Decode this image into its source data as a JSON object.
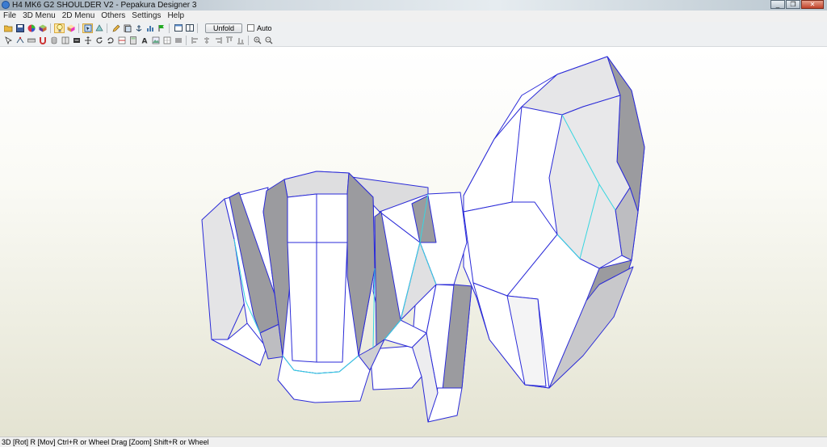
{
  "window": {
    "title": "H4 MK6 G2 SHOULDER V2 - Pepakura Designer 3",
    "minimize": "_",
    "restore": "❐",
    "close": "✕"
  },
  "menu": {
    "items": [
      "File",
      "3D Menu",
      "2D Menu",
      "Others",
      "Settings",
      "Help"
    ]
  },
  "toolbar": {
    "unfold_label": "Unfold",
    "auto_label": "Auto"
  },
  "status": {
    "text": "3D [Rot] R [Mov] Ctrl+R or Wheel Drag [Zoom] Shift+R or Wheel"
  },
  "colors": {
    "edge": "#2a2ad8",
    "fold_line": "#36d6e0",
    "face_white": "#ffffff",
    "face_light": "#e2e2e4",
    "face_grey": "#9b9b9f"
  }
}
